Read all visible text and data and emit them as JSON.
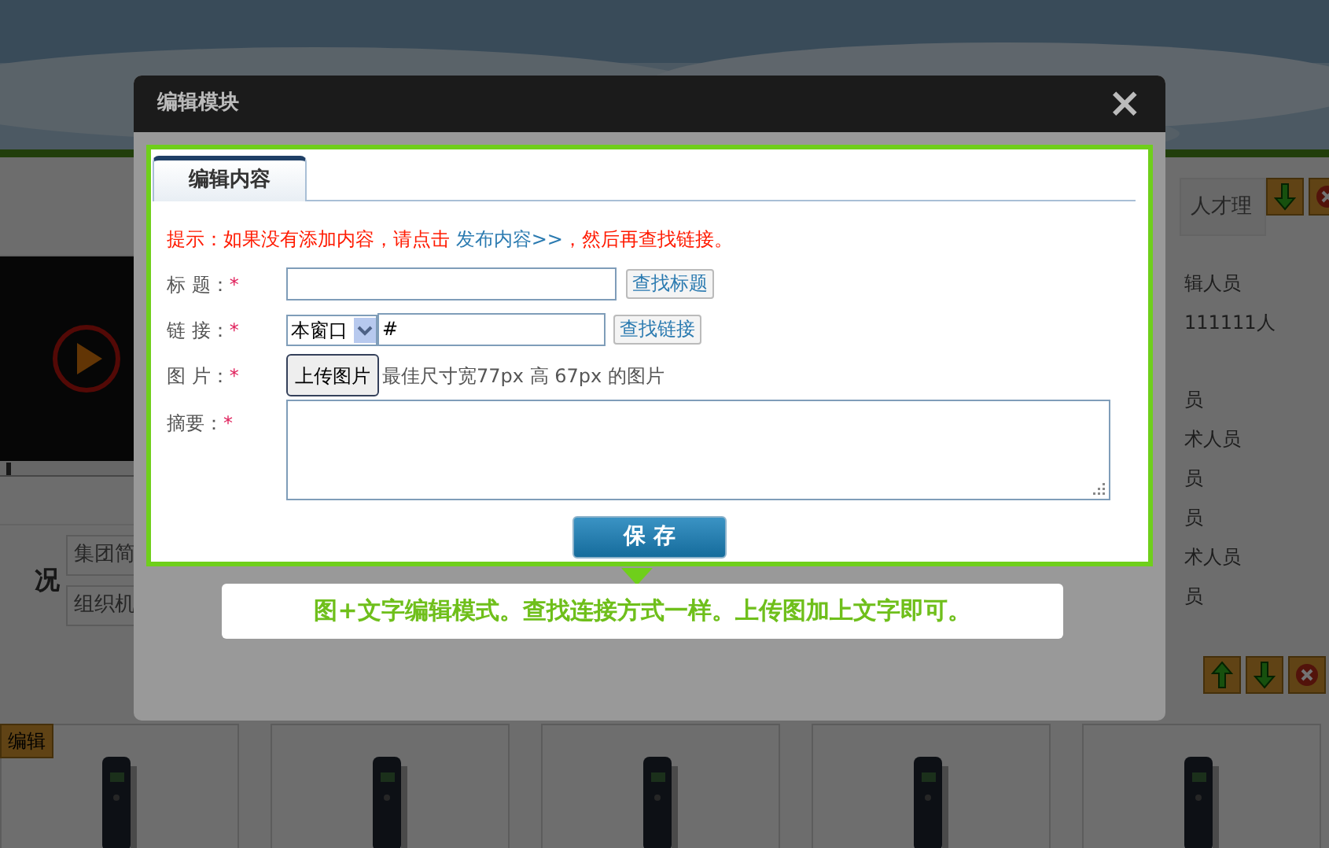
{
  "page": {
    "video_progress": {
      "level": 0.04
    },
    "section_tab": "人才理",
    "list_items": [
      "辑人员",
      "111111人",
      "员",
      "术人员",
      "员",
      "员",
      "术人员",
      "员"
    ],
    "section_title": "况",
    "nav_buttons": [
      "集团简",
      "组织机"
    ],
    "edit_button": "编辑"
  },
  "dialog": {
    "title": "编辑模块",
    "close": "×",
    "tabs": [
      {
        "label": "编辑内容",
        "selected": true
      }
    ],
    "tip": {
      "before": "提示：如果没有添加内容，请点击 ",
      "link": "发布内容>>",
      "after": "，然后再查找链接。"
    },
    "fields": [
      {
        "kind": "text",
        "label": "标 题：",
        "required_mark": "*",
        "button": "查找标题"
      },
      {
        "kind": "link",
        "label": "链 接：",
        "required_mark": "*",
        "select": "本窗口",
        "value": "#",
        "button": "查找链接"
      },
      {
        "kind": "upload",
        "label": "图 片：",
        "required_mark": "*",
        "button": "上传图片",
        "hint": "最佳尺寸宽77px 高 67px 的图片"
      },
      {
        "kind": "textarea",
        "label": "摘要：",
        "required_mark": "*"
      }
    ],
    "save_button": "保 存",
    "callout": "图+文字编辑模式。查找连接方式一样。上传图加上文字即可。"
  }
}
